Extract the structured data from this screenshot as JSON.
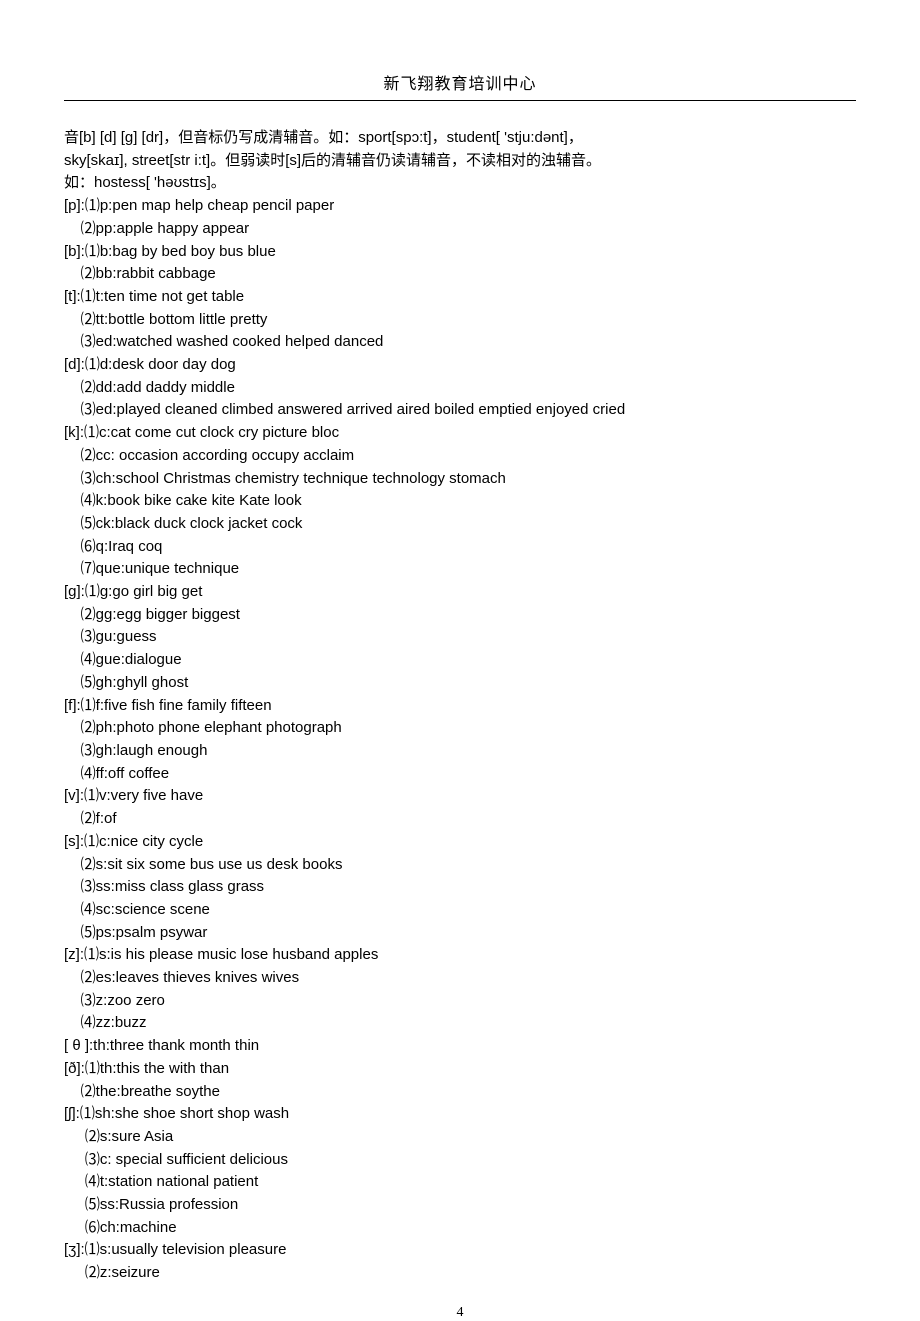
{
  "header": "新飞翔教育培训中心",
  "pagenum": "4",
  "lines": [
    "音[b] [d] [g] [dr]，但音标仍写成清辅音。如：sport[spɔ:t]，student[ 'stju:dənt]，",
    "sky[skaɪ], street[str i:t]。但弱读时[s]后的清辅音仍读请辅音，不读相对的浊辅音。",
    "如：hostess[ 'həʊstɪs]。",
    "[p]:⑴p:pen map help cheap pencil paper",
    "    ⑵pp:apple happy appear",
    "[b]:⑴b:bag by bed boy bus blue",
    "    ⑵bb:rabbit cabbage",
    "[t]:⑴t:ten time not get table",
    "    ⑵tt:bottle bottom little pretty",
    "    ⑶ed:watched washed cooked helped danced",
    "[d]:⑴d:desk door day dog",
    "    ⑵dd:add daddy middle",
    "    ⑶ed:played cleaned climbed answered arrived aired boiled emptied enjoyed cried",
    "[k]:⑴c:cat come cut clock cry picture bloc",
    "    ⑵cc: occasion according occupy acclaim",
    "    ⑶ch:school Christmas chemistry technique technology stomach",
    "    ⑷k:book bike cake kite Kate look",
    "    ⑸ck:black duck clock jacket cock",
    "    ⑹q:Iraq coq",
    "    ⑺que:unique technique",
    "[g]:⑴g:go girl big get",
    "    ⑵gg:egg bigger biggest",
    "    ⑶gu:guess",
    "    ⑷gue:dialogue",
    "    ⑸gh:ghyll ghost",
    "[f]:⑴f:five fish fine family fifteen",
    "    ⑵ph:photo phone elephant photograph",
    "    ⑶gh:laugh enough",
    "    ⑷ff:off coffee",
    "[v]:⑴v:very five have",
    "    ⑵f:of",
    "[s]:⑴c:nice city cycle",
    "    ⑵s:sit six some bus use us desk books",
    "    ⑶ss:miss class glass grass",
    "    ⑷sc:science scene",
    "    ⑸ps:psalm psywar",
    "[z]:⑴s:is his please music lose husband apples",
    "    ⑵es:leaves thieves knives wives",
    "    ⑶z:zoo zero",
    "    ⑷zz:buzz",
    "[ θ ]:th:three thank month thin",
    "[ð]:⑴th:this the with than",
    "    ⑵the:breathe soythe",
    "[ʃ]:⑴sh:she shoe short shop wash",
    "     ⑵s:sure Asia",
    "     ⑶c: special sufficient delicious",
    "     ⑷t:station national patient",
    "     ⑸ss:Russia profession",
    "     ⑹ch:machine",
    "[ʒ]:⑴s:usually television pleasure",
    "     ⑵z:seizure"
  ]
}
